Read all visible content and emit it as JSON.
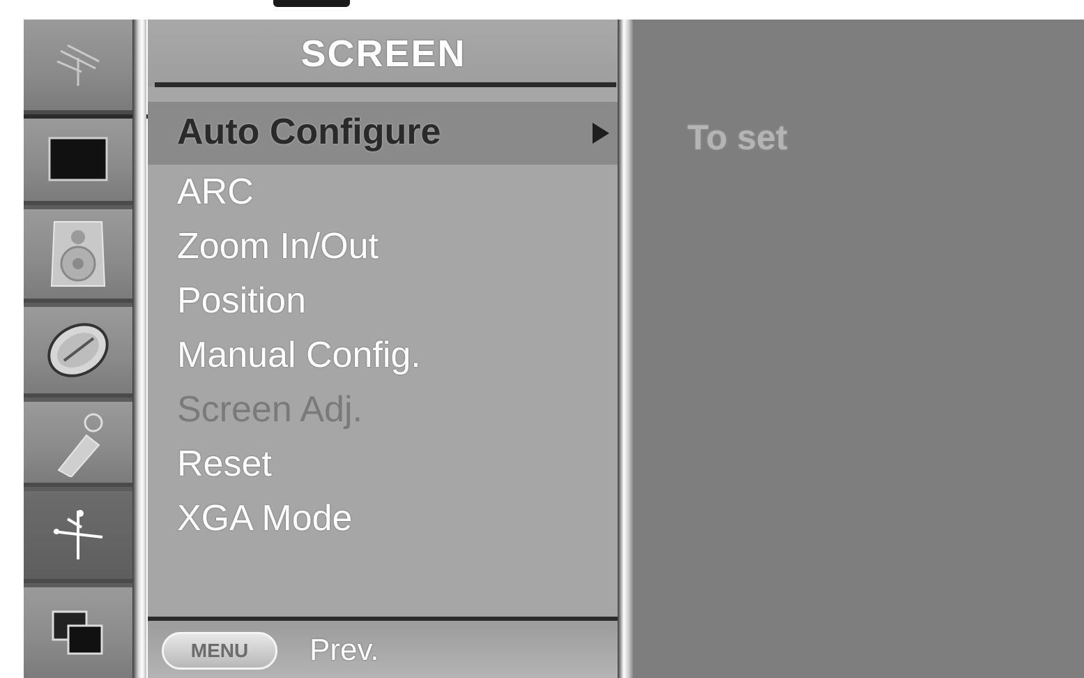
{
  "menu": {
    "title": "SCREEN",
    "items": [
      {
        "label": "Auto Configure",
        "state": "selected",
        "has_submenu": true
      },
      {
        "label": "ARC",
        "state": "normal"
      },
      {
        "label": "Zoom In/Out",
        "state": "normal"
      },
      {
        "label": "Position",
        "state": "normal"
      },
      {
        "label": "Manual Config.",
        "state": "normal"
      },
      {
        "label": "Screen Adj.",
        "state": "disabled"
      },
      {
        "label": "Reset",
        "state": "normal"
      },
      {
        "label": "XGA Mode",
        "state": "normal"
      }
    ]
  },
  "footer": {
    "key_label": "MENU",
    "action_label": "Prev."
  },
  "info": {
    "text": "To set"
  },
  "sidebar": {
    "items": [
      {
        "icon": "antenna-icon",
        "active": false
      },
      {
        "icon": "picture-icon",
        "active": false
      },
      {
        "icon": "speaker-icon",
        "active": false
      },
      {
        "icon": "time-icon",
        "active": false
      },
      {
        "icon": "special-icon",
        "active": false
      },
      {
        "icon": "screen-icon",
        "active": true
      },
      {
        "icon": "pip-icon",
        "active": false
      }
    ]
  },
  "colors": {
    "panel_bg": "#a6a6a6",
    "selected_bg": "#8a8a8a",
    "info_bg": "#7e7e7e",
    "text": "#ffffff",
    "disabled_text": "#7a7a7a"
  }
}
